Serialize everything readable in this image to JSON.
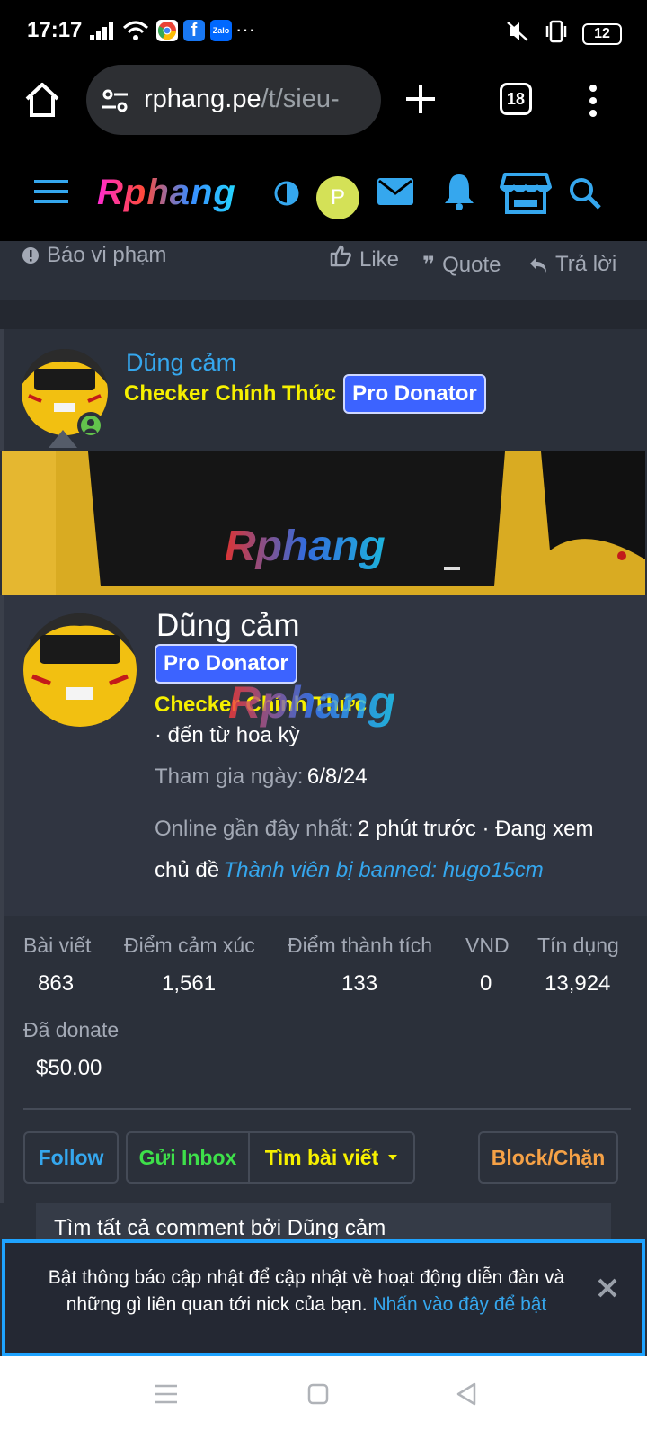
{
  "status_bar": {
    "time": "17:17",
    "app_icons": [
      {
        "icon": "chrome-icon",
        "label": "",
        "color": "#ffffff"
      },
      {
        "icon": "facebook-icon",
        "label": "f",
        "color": "#1877f2"
      },
      {
        "icon": "zalo-icon",
        "label": "Zalo",
        "color": "#0068ff"
      }
    ],
    "more": "···",
    "battery": "12"
  },
  "browser": {
    "url_domain": "rphang.pe",
    "url_path": "/t/sieu-",
    "tab_count": "18"
  },
  "site_header": {
    "logo": "Rphang",
    "avatar_letter": "P",
    "accent_color": "#35a7ee"
  },
  "post_actions": {
    "report": "Báo vi phạm",
    "like": "Like",
    "quote": "Quote",
    "reply": "Trả lời"
  },
  "post_header": {
    "username": "Dũng cảm",
    "title": "Checker Chính Thức",
    "badge": "Pro Donator"
  },
  "banner": {
    "watermark": "Rphang"
  },
  "profile": {
    "name": "Dũng cảm",
    "badge": "Pro Donator",
    "title": "Checker Chính Thức",
    "from": "· đến từ hoa kỳ",
    "joined_label": "Tham gia ngày:",
    "joined_value": "6/8/24",
    "online_label": "Online gần đây nhất:",
    "online_value": "2 phút trước · Đang xem",
    "viewing_prefix": "chủ đề",
    "viewing_link": "Thành viên bị banned: hugo15cm",
    "watermark": "Rphang"
  },
  "stats": [
    {
      "label": "Bài viết",
      "value": "863"
    },
    {
      "label": "Điểm cảm xúc",
      "value": "1,561"
    },
    {
      "label": "Điểm thành tích",
      "value": "133"
    },
    {
      "label": "VND",
      "value": "0"
    },
    {
      "label": "Tín dụng",
      "value": "13,924"
    },
    {
      "label": "Đã donate",
      "value": "$50.00"
    }
  ],
  "buttons": {
    "follow": "Follow",
    "inbox": "Gửi Inbox",
    "find_posts": "Tìm bài viết",
    "block": "Block/Chặn",
    "colors": {
      "follow": "#35a7ee",
      "inbox": "#3ee04a",
      "find_posts": "#f6f000",
      "block": "#f5a146"
    }
  },
  "dropdown": {
    "first_item": "Tìm tất cả comment bởi Dũng cảm"
  },
  "notice": {
    "text": "Bật thông báo cập nhật để cập nhật về hoạt động diễn đàn và những gì liên quan tới nick của bạn.",
    "link": "Nhấn vào đây để bật"
  }
}
